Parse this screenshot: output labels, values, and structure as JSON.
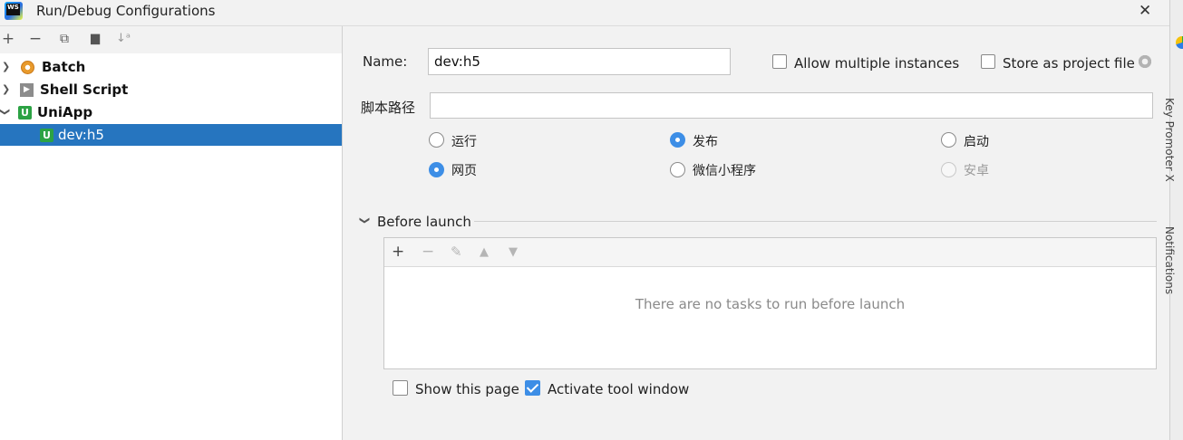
{
  "window": {
    "title": "Run/Debug Configurations",
    "app_icon_text": "WS"
  },
  "toolbar": {
    "add": "+",
    "remove": "−",
    "copy": "⧉",
    "folder": "▆",
    "sort": "↓ᵃ"
  },
  "tree": {
    "items": [
      {
        "label": "Batch"
      },
      {
        "label": "Shell Script"
      },
      {
        "label": "UniApp"
      },
      {
        "label": "dev:h5"
      }
    ]
  },
  "form": {
    "name_label": "Name:",
    "name_value": "dev:h5",
    "allow_multiple": "Allow multiple instances",
    "store_project": "Store as project file",
    "script_path_label": "脚本路径",
    "script_path_value": "",
    "radios_row1": [
      "运行",
      "发布",
      "启动"
    ],
    "radios_row2": [
      "网页",
      "微信小程序",
      "安卓"
    ]
  },
  "before_launch": {
    "title": "Before launch",
    "empty_text": "There are no tasks to run before launch"
  },
  "footer": {
    "show_page": "Show this page",
    "activate_tool": "Activate tool window"
  },
  "side": {
    "text1": "Key Promoter X",
    "text2": "Notifications"
  },
  "colors": {
    "selection": "#2675bf",
    "accent": "#3d8ee6",
    "uniapp_green": "#2ca244"
  }
}
